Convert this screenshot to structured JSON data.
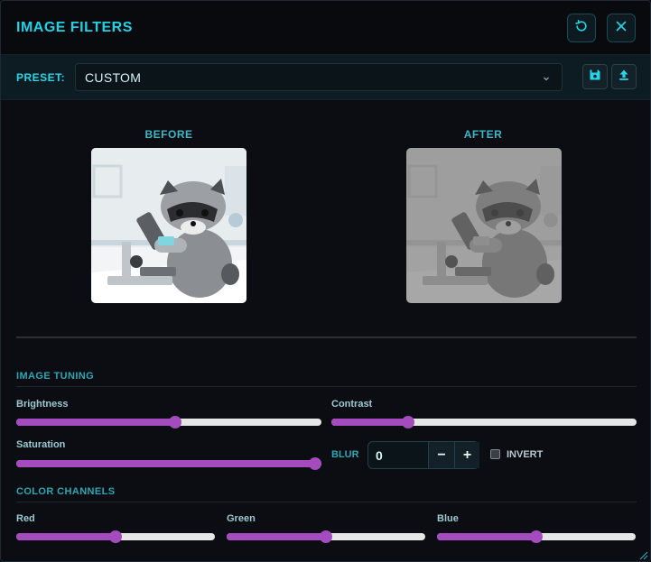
{
  "window": {
    "title": "IMAGE FILTERS"
  },
  "preset": {
    "label": "PRESET:",
    "value": "CUSTOM"
  },
  "preview": {
    "before_label": "BEFORE",
    "after_label": "AFTER"
  },
  "image_tuning": {
    "heading": "IMAGE TUNING",
    "brightness": {
      "label": "Brightness",
      "fraction": 0.52
    },
    "contrast": {
      "label": "Contrast",
      "fraction": 0.25
    },
    "saturation": {
      "label": "Saturation",
      "fraction": 0.98
    },
    "blur": {
      "label": "BLUR",
      "value": "0",
      "minus": "−",
      "plus": "+"
    },
    "invert": {
      "label": "INVERT",
      "checked": false
    }
  },
  "color_channels": {
    "heading": "COLOR CHANNELS",
    "red": {
      "label": "Red",
      "fraction": 0.5
    },
    "green": {
      "label": "Green",
      "fraction": 0.5
    },
    "blue": {
      "label": "Blue",
      "fraction": 0.5
    }
  },
  "icons": {
    "reset": "reset-icon",
    "close": "close-icon",
    "save": "save-icon",
    "upload": "upload-icon",
    "dropdown": "chevron-down-icon"
  },
  "colors": {
    "accent": "#1ed3e6",
    "slider_fill": "#a44cbd",
    "slider_track": "#e6e6e6"
  }
}
